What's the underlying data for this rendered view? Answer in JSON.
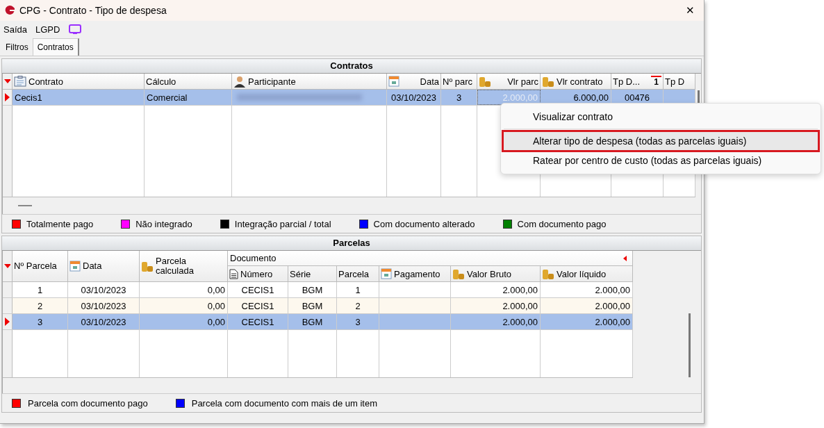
{
  "window": {
    "title": "CPG - Contrato - Tipo de despesa",
    "close": "✕"
  },
  "menu": [
    {
      "label": "Saída"
    },
    {
      "label": "LGPD"
    }
  ],
  "tabs": [
    {
      "label": "Filtros",
      "selected": false
    },
    {
      "label": "Contratos",
      "selected": true
    }
  ],
  "contratos": {
    "title": "Contratos",
    "columns": [
      {
        "label": "Contrato"
      },
      {
        "label": "Cálculo"
      },
      {
        "label": "Participante"
      },
      {
        "label": "Data"
      },
      {
        "label": "Nº parc"
      },
      {
        "label": "Vlr parc"
      },
      {
        "label": "Vlr contrato"
      },
      {
        "label": "Tp D...",
        "sort": "1"
      },
      {
        "label": "Tp D"
      }
    ],
    "rows": [
      {
        "selected": true,
        "contrato": "Cecis1",
        "calculo": "Comercial",
        "data": "03/10/2023",
        "n_parc": "3",
        "vlr_parc": "2.000,00",
        "vlr_contrato": "6.000,00",
        "tp_d": "00476"
      }
    ],
    "legend": [
      {
        "label": "Totalmente pago",
        "color": "#ff0000"
      },
      {
        "label": "Não integrado",
        "color": "#ff00ff"
      },
      {
        "label": "Integração parcial / total",
        "color": "#000000"
      },
      {
        "label": "Com documento alterado",
        "color": "#0000ff"
      },
      {
        "label": "Com documento pago",
        "color": "#008000"
      }
    ]
  },
  "parcelas": {
    "title": "Parcelas",
    "group": "Documento",
    "columns": [
      {
        "label": "Nº Parcela"
      },
      {
        "label": "Data"
      },
      {
        "label": "Parcela calculada"
      },
      {
        "label": "Número"
      },
      {
        "label": "Série"
      },
      {
        "label": "Parcela"
      },
      {
        "label": "Pagamento"
      },
      {
        "label": "Valor Bruto"
      },
      {
        "label": "Valor líquido"
      }
    ],
    "rows": [
      {
        "selected": false,
        "cells": [
          "1",
          "03/10/2023",
          "0,00",
          "CECIS1",
          "BGM",
          "1",
          "",
          "2.000,00",
          "2.000,00"
        ]
      },
      {
        "selected": false,
        "cells": [
          "2",
          "03/10/2023",
          "0,00",
          "CECIS1",
          "BGM",
          "2",
          "",
          "2.000,00",
          "2.000,00"
        ]
      },
      {
        "selected": true,
        "cells": [
          "3",
          "03/10/2023",
          "0,00",
          "CECIS1",
          "BGM",
          "3",
          "",
          "2.000,00",
          "2.000,00"
        ]
      }
    ],
    "legend": [
      {
        "label": "Parcela com documento pago",
        "color": "#ff0000"
      },
      {
        "label": "Parcela com documento com mais de um item",
        "color": "#0000ff"
      }
    ]
  },
  "context_menu": [
    {
      "label": "Visualizar contrato",
      "highlighted": false
    },
    {
      "label": "Alterar tipo de despesa (todas as parcelas iguais)",
      "highlighted": true
    },
    {
      "label": "Ratear por centro de custo (todas as parcelas iguais)",
      "highlighted": false
    }
  ]
}
